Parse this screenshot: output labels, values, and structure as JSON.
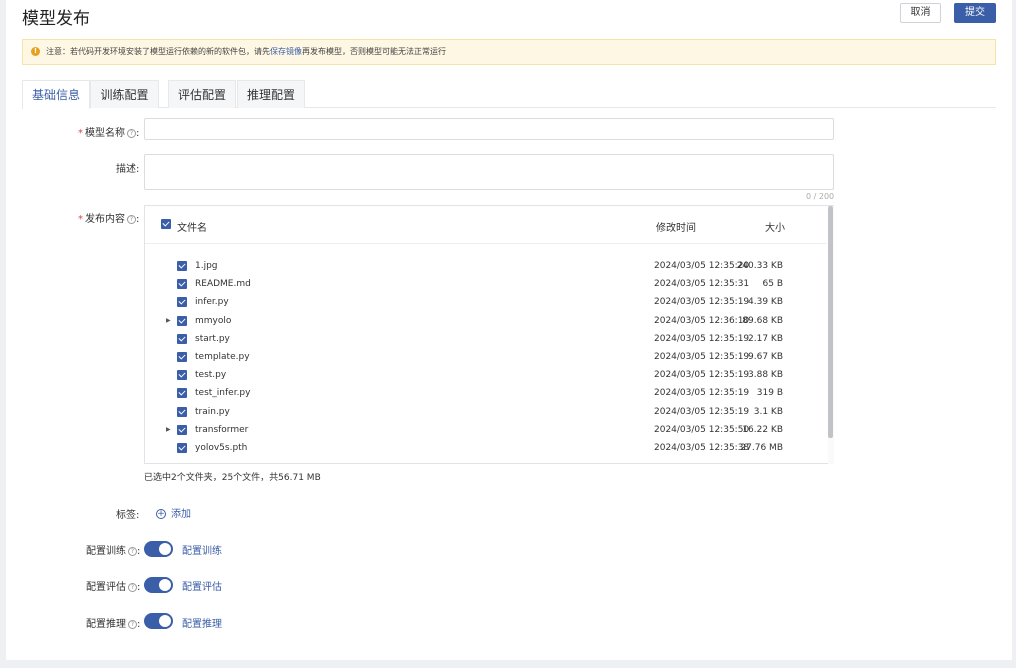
{
  "header": {
    "title": "模型发布",
    "cancel_label": "取消",
    "submit_label": "提交"
  },
  "notice": {
    "icon": "warning-icon",
    "text_before": "注意：若代码开发环境安装了模型运行依赖的新的软件包，请先",
    "link": "保存镜像",
    "text_after": "再发布模型，否则模型可能无法正常运行"
  },
  "tabs": [
    {
      "label": "基础信息",
      "active": true
    },
    {
      "label": "训练配置",
      "active": false
    },
    {
      "label": "评估配置",
      "active": false
    },
    {
      "label": "推理配置",
      "active": false
    }
  ],
  "form": {
    "model_name": {
      "label": "模型名称",
      "required": true,
      "value": "",
      "help_icon": "question-circle-icon"
    },
    "description": {
      "label": "描述:",
      "value": "",
      "counter": "0 / 200"
    },
    "content": {
      "label": "发布内容",
      "required": true,
      "columns": {
        "name": "文件名",
        "time": "修改时间",
        "size": "大小"
      },
      "files": [
        {
          "name": "1.jpg",
          "time": "2024/03/05 12:35:20",
          "size": "240.33 KB",
          "folder": false
        },
        {
          "name": "README.md",
          "time": "2024/03/05 12:35:31",
          "size": "65 B",
          "folder": false
        },
        {
          "name": "infer.py",
          "time": "2024/03/05 12:35:19",
          "size": "4.39 KB",
          "folder": false
        },
        {
          "name": "mmyolo",
          "time": "2024/03/05 12:36:10",
          "size": "89.68 KB",
          "folder": true
        },
        {
          "name": "start.py",
          "time": "2024/03/05 12:35:19",
          "size": "2.17 KB",
          "folder": false
        },
        {
          "name": "template.py",
          "time": "2024/03/05 12:35:19",
          "size": "9.67 KB",
          "folder": false
        },
        {
          "name": "test.py",
          "time": "2024/03/05 12:35:19",
          "size": "3.88 KB",
          "folder": false
        },
        {
          "name": "test_infer.py",
          "time": "2024/03/05 12:35:19",
          "size": "319 B",
          "folder": false
        },
        {
          "name": "train.py",
          "time": "2024/03/05 12:35:19",
          "size": "3.1 KB",
          "folder": false
        },
        {
          "name": "transformer",
          "time": "2024/03/05 12:35:50",
          "size": "16.22 KB",
          "folder": true
        },
        {
          "name": "yolov5s.pth",
          "time": "2024/03/05 12:35:38",
          "size": "27.76 MB",
          "folder": false
        }
      ],
      "summary": "已选中2个文件夹，25个文件，共56.71 MB"
    },
    "tags": {
      "label": "标签:",
      "add_label": "添加"
    },
    "toggles": [
      {
        "label": "配置训练",
        "link": "配置训练",
        "on": true
      },
      {
        "label": "配置评估",
        "link": "配置评估",
        "on": true
      },
      {
        "label": "配置推理",
        "link": "配置推理",
        "on": true
      }
    ]
  },
  "colors": {
    "accent": "#3a5ea7",
    "required": "#e2424b",
    "notice_bg": "#fdf7e4"
  }
}
